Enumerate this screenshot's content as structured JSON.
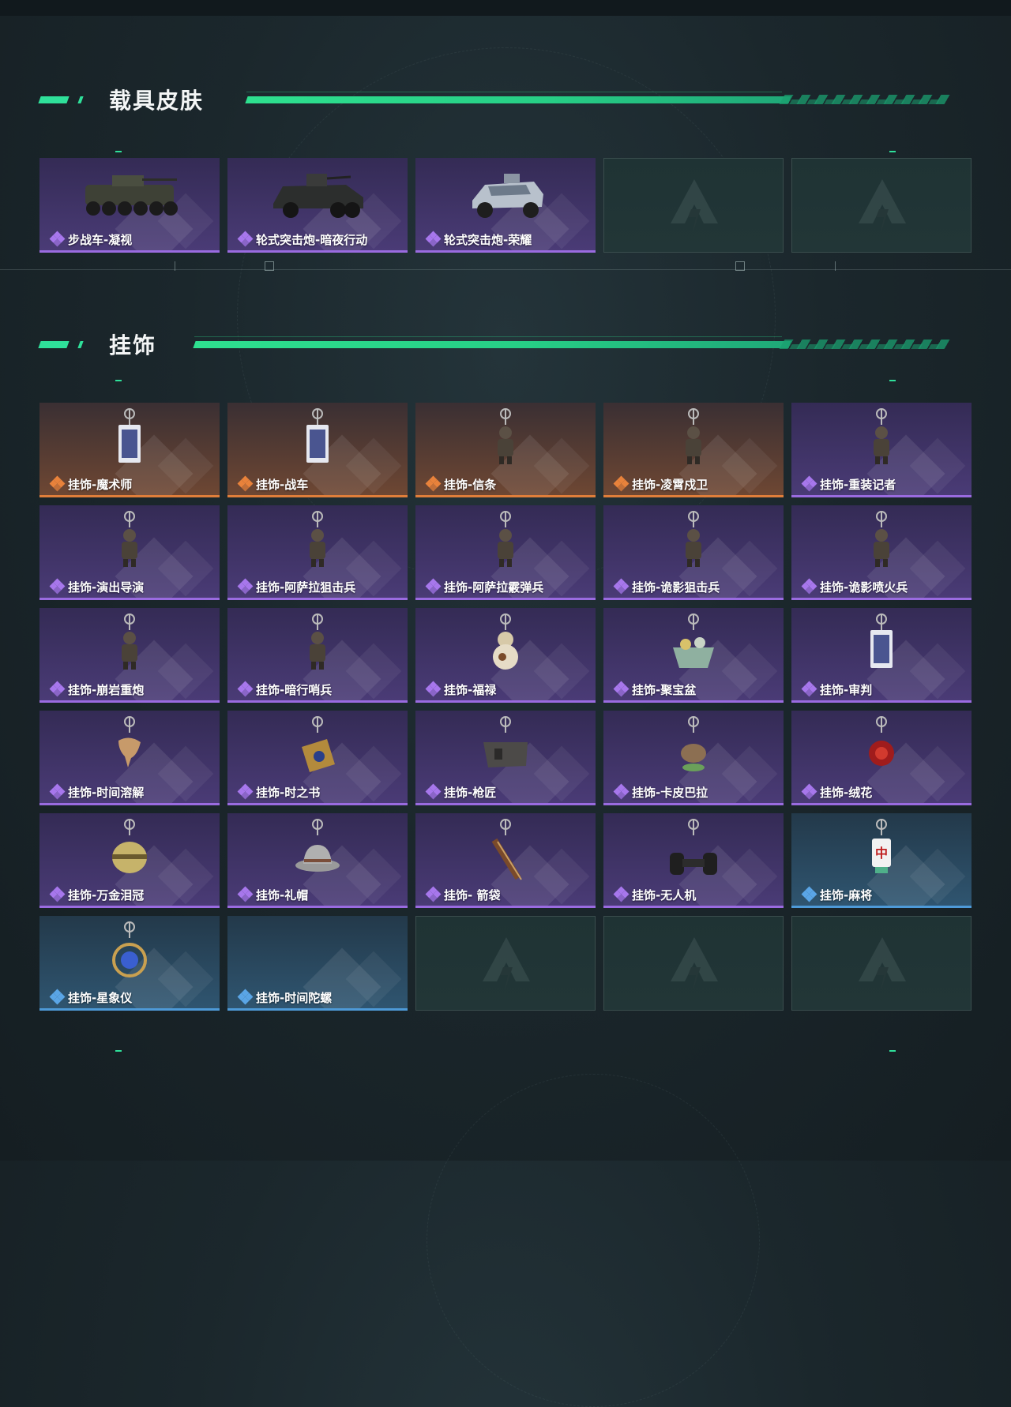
{
  "sections": {
    "vehicle": {
      "title": "载具皮肤",
      "items": [
        {
          "name": "步战车-凝视",
          "rarity": "purple",
          "icon": "ifv-vehicle-icon"
        },
        {
          "name": "轮式突击炮-暗夜行动",
          "rarity": "purple",
          "icon": "armored-car-icon"
        },
        {
          "name": "轮式突击炮-荣耀",
          "rarity": "purple",
          "icon": "assault-buggy-icon"
        },
        {
          "name": "",
          "rarity": "empty"
        },
        {
          "name": "",
          "rarity": "empty"
        }
      ]
    },
    "charms": {
      "title": "挂饰",
      "items": [
        {
          "name": "挂饰-魔术师",
          "rarity": "orange",
          "icon": "tarot-card-charm-icon"
        },
        {
          "name": "挂饰-战车",
          "rarity": "orange",
          "icon": "tarot-card-charm-icon"
        },
        {
          "name": "挂饰-信条",
          "rarity": "orange",
          "icon": "figure-charm-icon"
        },
        {
          "name": "挂饰-凌霄戍卫",
          "rarity": "orange",
          "icon": "figure-charm-icon"
        },
        {
          "name": "挂饰-重装记者",
          "rarity": "purple",
          "icon": "figure-charm-icon"
        },
        {
          "name": "挂饰-演出导演",
          "rarity": "purple",
          "icon": "figure-charm-icon"
        },
        {
          "name": "挂饰-阿萨拉狙击兵",
          "rarity": "purple",
          "icon": "figure-charm-icon"
        },
        {
          "name": "挂饰-阿萨拉霰弹兵",
          "rarity": "purple",
          "icon": "figure-charm-icon"
        },
        {
          "name": "挂饰-诡影狙击兵",
          "rarity": "purple",
          "icon": "figure-charm-icon"
        },
        {
          "name": "挂饰-诡影喷火兵",
          "rarity": "purple",
          "icon": "figure-charm-icon"
        },
        {
          "name": "挂饰-崩岩重炮",
          "rarity": "purple",
          "icon": "figure-charm-icon"
        },
        {
          "name": "挂饰-暗行哨兵",
          "rarity": "purple",
          "icon": "figure-charm-icon"
        },
        {
          "name": "挂饰-福禄",
          "rarity": "purple",
          "icon": "gourd-charm-icon"
        },
        {
          "name": "挂饰-聚宝盆",
          "rarity": "purple",
          "icon": "treasure-bowl-charm-icon"
        },
        {
          "name": "挂饰-审判",
          "rarity": "purple",
          "icon": "tarot-card-charm-icon"
        },
        {
          "name": "挂饰-时间溶解",
          "rarity": "purple",
          "icon": "melting-clock-charm-icon"
        },
        {
          "name": "挂饰-时之书",
          "rarity": "purple",
          "icon": "book-charm-icon"
        },
        {
          "name": "挂饰-枪匠",
          "rarity": "purple",
          "icon": "gun-part-charm-icon"
        },
        {
          "name": "挂饰-卡皮巴拉",
          "rarity": "purple",
          "icon": "capybara-charm-icon"
        },
        {
          "name": "挂饰-绒花",
          "rarity": "purple",
          "icon": "flower-charm-icon"
        },
        {
          "name": "挂饰-万金泪冠",
          "rarity": "purple",
          "icon": "crown-charm-icon"
        },
        {
          "name": "挂饰-礼帽",
          "rarity": "purple",
          "icon": "hat-charm-icon"
        },
        {
          "name": "挂饰- 箭袋",
          "rarity": "purple",
          "icon": "quiver-charm-icon"
        },
        {
          "name": "挂饰-无人机",
          "rarity": "purple",
          "icon": "drone-charm-icon"
        },
        {
          "name": "挂饰-麻将",
          "rarity": "blue",
          "icon": "mahjong-tile-charm-icon"
        },
        {
          "name": "挂饰-星象仪",
          "rarity": "blue",
          "icon": "astrolabe-charm-icon"
        },
        {
          "name": "挂饰-时间陀螺",
          "rarity": "blue",
          "icon": "none"
        },
        {
          "name": "",
          "rarity": "empty"
        },
        {
          "name": "",
          "rarity": "empty"
        },
        {
          "name": "",
          "rarity": "empty"
        }
      ]
    }
  },
  "colors": {
    "accent": "#2fe09a",
    "purple": "#9a6be0",
    "orange": "#e07e3a",
    "blue": "#4e9ad8"
  }
}
